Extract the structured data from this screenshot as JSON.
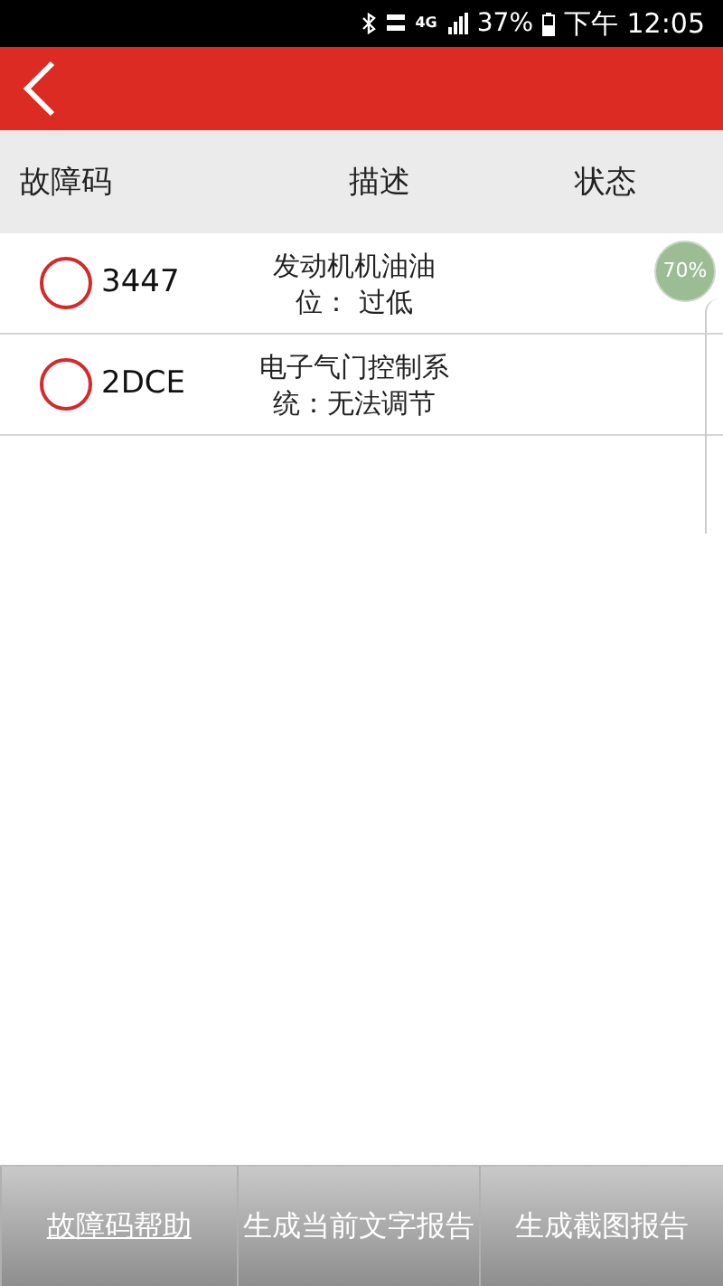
{
  "status_bar": {
    "battery": "37%",
    "time": "下午 12:05",
    "network": "4G"
  },
  "columns": [
    "故障码",
    "描述",
    "状态"
  ],
  "rows": [
    {
      "code": "3447",
      "description": [
        "发动机机油油",
        "位： 过低"
      ],
      "selected": false
    },
    {
      "code": "2DCE",
      "description": [
        "电子气门控制系",
        "统：无法调节"
      ],
      "selected": false
    }
  ],
  "progress": "70%",
  "buttons": [
    {
      "label": "故障码帮助",
      "kind": "link"
    },
    {
      "label": "生成当前文字报告",
      "kind": "plain"
    },
    {
      "label": "生成截图报告",
      "kind": "plain"
    }
  ]
}
